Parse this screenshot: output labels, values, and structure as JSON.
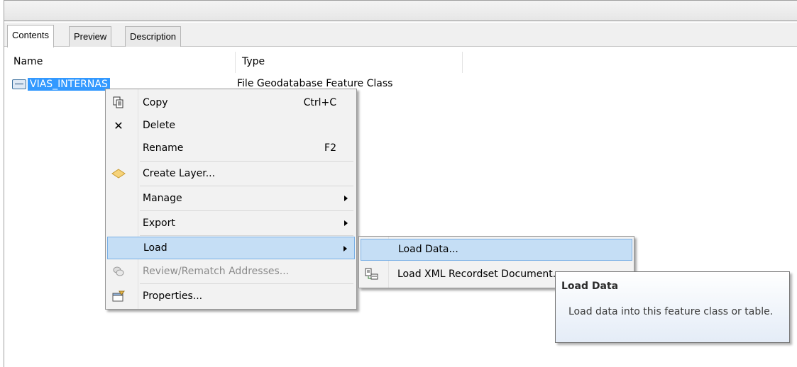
{
  "tabs": [
    {
      "label": "Contents",
      "active": true
    },
    {
      "label": "Preview",
      "active": false
    },
    {
      "label": "Description",
      "active": false
    }
  ],
  "columns": {
    "name": "Name",
    "type": "Type"
  },
  "item": {
    "name": "VIAS_INTERNAS",
    "type": "File Geodatabase Feature Class",
    "icon": "line-feature-class-icon"
  },
  "context_menu": {
    "items": [
      {
        "label": "Copy",
        "shortcut": "Ctrl+C",
        "icon": "copy-icon"
      },
      {
        "label": "Delete",
        "shortcut": "",
        "icon": "delete-icon"
      },
      {
        "label": "Rename",
        "shortcut": "F2",
        "icon": ""
      },
      {
        "label": "Create Layer...",
        "shortcut": "",
        "icon": "layer-icon"
      },
      {
        "label": "Manage",
        "shortcut": "",
        "icon": "",
        "submenu": true
      },
      {
        "label": "Export",
        "shortcut": "",
        "icon": "",
        "submenu": true
      },
      {
        "label": "Load",
        "shortcut": "",
        "icon": "",
        "submenu": true,
        "highlighted": true
      },
      {
        "label": "Review/Rematch Addresses...",
        "shortcut": "",
        "icon": "review-addresses-icon",
        "disabled": true
      },
      {
        "label": "Properties...",
        "shortcut": "",
        "icon": "properties-icon"
      }
    ]
  },
  "submenu": {
    "items": [
      {
        "label": "Load Data...",
        "highlighted": true,
        "icon": ""
      },
      {
        "label": "Load XML Recordset Document...",
        "icon": "xml-recordset-icon"
      }
    ]
  },
  "tooltip": {
    "title": "Load Data",
    "body": "Load data into this feature class or table."
  },
  "colors": {
    "selection": "#3399ff",
    "menu_highlight": "#c5def5",
    "menu_bg": "#f2f2f2"
  }
}
